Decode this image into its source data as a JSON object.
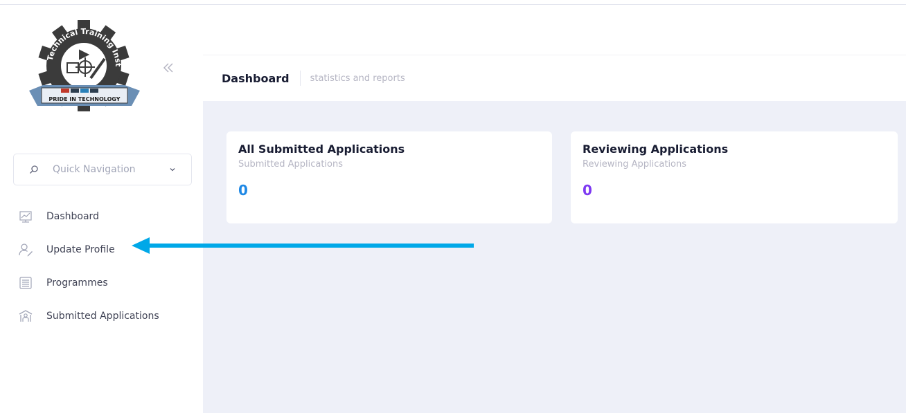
{
  "sidebar": {
    "logo": {
      "ring_text": "Thika Technical Training Institute",
      "motto": "PRIDE IN TECHNOLOGY"
    },
    "collapse_icon": "double-chevron-left",
    "quick_nav": {
      "label": "Quick Navigation"
    },
    "items": [
      {
        "label": "Dashboard",
        "icon": "chart-icon"
      },
      {
        "label": "Update Profile",
        "icon": "user-edit-icon"
      },
      {
        "label": "Programmes",
        "icon": "list-icon"
      },
      {
        "label": "Submitted Applications",
        "icon": "institution-icon"
      }
    ]
  },
  "header": {
    "title": "Dashboard",
    "description": "statistics and reports"
  },
  "cards": [
    {
      "title": "All Submitted Applications",
      "subtitle": "Submitted Applications",
      "value": "0",
      "color": "#1e88e5"
    },
    {
      "title": "Reviewing Applications",
      "subtitle": "Reviewing Applications",
      "value": "0",
      "color": "#7e3af2"
    }
  ],
  "colors": {
    "annotation_arrow": "#00a8e8",
    "content_bg": "#eef0f8"
  }
}
